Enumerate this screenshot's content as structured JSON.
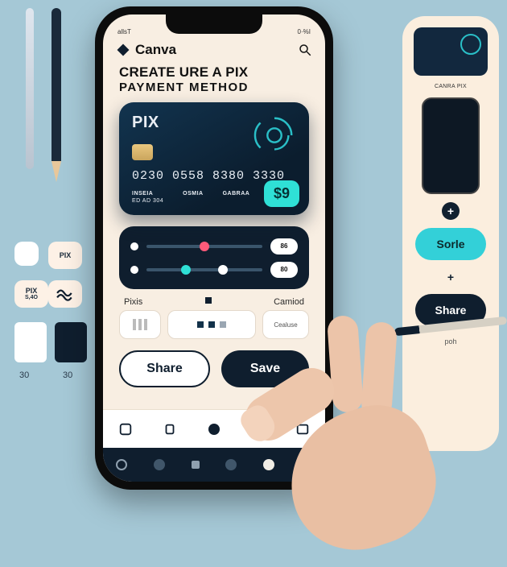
{
  "colors": {
    "accent": "#2fe0d6",
    "dark": "#0f1e2e",
    "panel": "#fbeede",
    "canvas": "#f8eee2"
  },
  "desk": {
    "chip2": "PIX",
    "chip3": "PIX",
    "chip3_sub": "S,4O",
    "num_left": "30",
    "num_right": "30"
  },
  "side": {
    "caption": "CANRA PIX",
    "sorle": "Sorle",
    "plus": "+",
    "share": "Share",
    "foot": "poh"
  },
  "phone": {
    "status_left": "allsT",
    "status_right": "0·%I",
    "brand": "Canva",
    "title_line1": "CREATE URE A PIX",
    "title_line2": "PAYMENT METHOD",
    "card": {
      "brand": "PIX",
      "digits": [
        "0230",
        "0558",
        "8380",
        "3330"
      ],
      "labels": [
        "INSEIA",
        "OSMIA",
        "GABRAA"
      ],
      "holder": "ED AD 304",
      "price": "$9"
    },
    "slider_pills": [
      "86",
      "80"
    ],
    "labels_row": {
      "left": "Pixis",
      "right": "Camiod"
    },
    "mini_right": "Cealuse",
    "actions": {
      "share": "Share",
      "save": "Save"
    }
  }
}
